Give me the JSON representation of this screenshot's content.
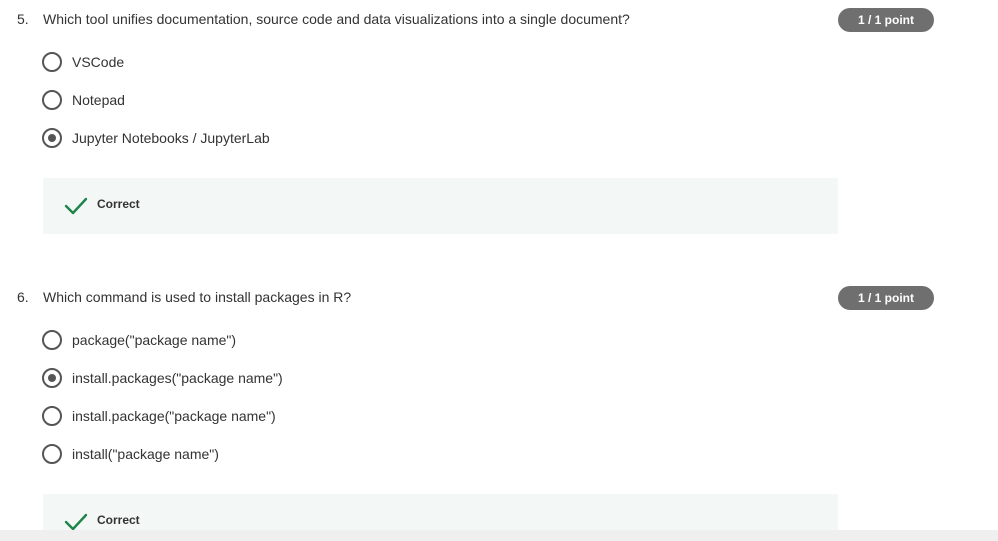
{
  "questions": [
    {
      "number": "5.",
      "text": "Which tool unifies documentation, source code and data visualizations into a single document?",
      "points": "1 / 1 point",
      "options": [
        {
          "label": "VSCode",
          "selected": false
        },
        {
          "label": "Notepad",
          "selected": false
        },
        {
          "label": "Jupyter Notebooks / JupyterLab",
          "selected": true
        }
      ],
      "feedback": "Correct"
    },
    {
      "number": "6.",
      "text": "Which command is used to install packages in R?",
      "points": "1 / 1 point",
      "options": [
        {
          "label": "package(\"package name\")",
          "selected": false
        },
        {
          "label": "install.packages(\"package name\")",
          "selected": true
        },
        {
          "label": "install.package(\"package name\")",
          "selected": false
        },
        {
          "label": "install(\"package name\")",
          "selected": false
        }
      ],
      "feedback": "Correct"
    }
  ],
  "colors": {
    "badge": "#6f6f6f",
    "feedback_bg": "#f3f8f6",
    "check": "#1e8449"
  },
  "icons": {
    "correct": "check-icon",
    "radio": "radio-icon"
  }
}
